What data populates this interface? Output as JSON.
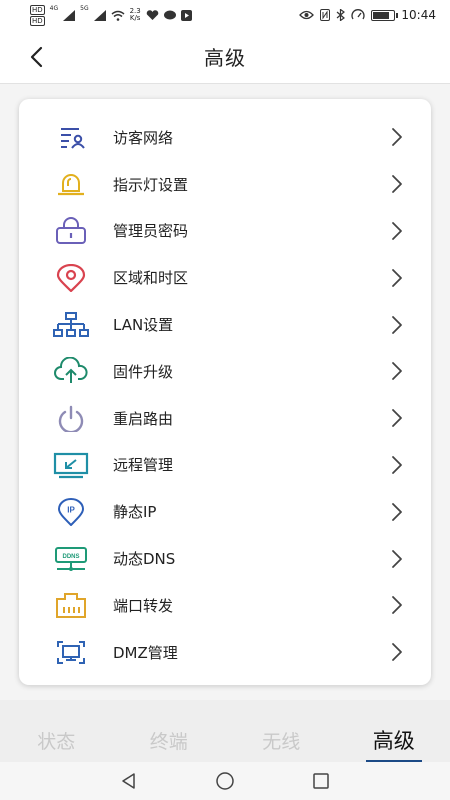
{
  "status_bar": {
    "chip_top": "HD",
    "chip_bottom": "HD",
    "signal1_label": "4G",
    "signal2_label": "5G",
    "speed_value": "2.3",
    "speed_unit": "K/s",
    "time": "10:44",
    "battery_level": 0.8
  },
  "header": {
    "title": "高级"
  },
  "menu": [
    {
      "label": "访客网络",
      "icon": "guest-network-icon",
      "color": "#3b4fa8"
    },
    {
      "label": "指示灯设置",
      "icon": "indicator-light-icon",
      "color": "#e2b01e"
    },
    {
      "label": "管理员密码",
      "icon": "lock-icon",
      "color": "#6a60b8"
    },
    {
      "label": "区域和时区",
      "icon": "location-pin-icon",
      "color": "#d9434f"
    },
    {
      "label": "LAN设置",
      "icon": "lan-network-icon",
      "color": "#2f63b4"
    },
    {
      "label": "固件升级",
      "icon": "cloud-upload-icon",
      "color": "#1e8a6b"
    },
    {
      "label": "重启路由",
      "icon": "power-icon",
      "color": "#8e8bb5"
    },
    {
      "label": "远程管理",
      "icon": "remote-screen-icon",
      "color": "#1f8fa6"
    },
    {
      "label": "静态IP",
      "icon": "ip-pin-icon",
      "color": "#2e5fb8"
    },
    {
      "label": "动态DNS",
      "icon": "ddns-icon",
      "color": "#1e9a77"
    },
    {
      "label": "端口转发",
      "icon": "port-forward-icon",
      "color": "#e0a52a"
    },
    {
      "label": "DMZ管理",
      "icon": "dmz-icon",
      "color": "#2f63b4"
    }
  ],
  "tabs": [
    {
      "label": "状态",
      "active": false
    },
    {
      "label": "终端",
      "active": false
    },
    {
      "label": "无线",
      "active": false
    },
    {
      "label": "高级",
      "active": true
    }
  ],
  "colors": {
    "accent": "#1c4a86",
    "inactive_tab": "#c9c9c9"
  }
}
